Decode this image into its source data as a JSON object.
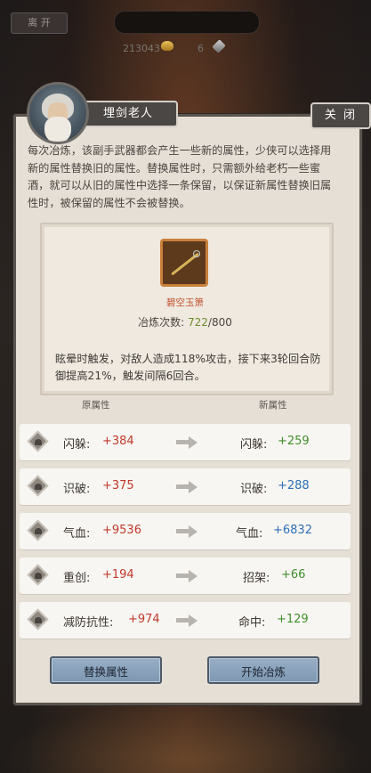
{
  "topbar": {
    "leave_label": "离 开",
    "title": "",
    "coins": "213043",
    "gems": "6",
    "coin_icon": "coin-icon",
    "gem_icon": "gem-icon"
  },
  "npc": {
    "name": "埋剑老人",
    "avatar_icon": "old-sage-avatar"
  },
  "close_label": "关 闭",
  "description": "每次冶炼，该副手武器都会产生一些新的属性，少侠可以选择用新的属性替换旧的属性。替换属性时，只需额外给老朽一些蜜酒，就可以从旧的属性中选择一条保留，以保证新属性替换旧属性时，被保留的属性不会被替换。",
  "item": {
    "name": "碧空玉箫",
    "refine_label": "冶炼次数:",
    "refine_current": "722",
    "refine_max": "/800",
    "effect": "眩晕时触发，对敌人造成118%攻击，接下来3轮回合防御提高21%，触发间隔6回合。",
    "icon": "jade-flute-icon"
  },
  "headers": {
    "old": "原属性",
    "new": "新属性"
  },
  "attributes": [
    {
      "old_label": "闪躲:",
      "old_value": "+384",
      "new_label": "闪躲:",
      "new_value": "+259",
      "new_color": "#3f8f2a"
    },
    {
      "old_label": "识破:",
      "old_value": "+375",
      "new_label": "识破:",
      "new_value": "+288",
      "new_color": "#2f6fb5"
    },
    {
      "old_label": "气血:",
      "old_value": "+9536",
      "new_label": "气血:",
      "new_value": "+6832",
      "new_color": "#2f6fb5"
    },
    {
      "old_label": "重创:",
      "old_value": "+194",
      "new_label": "招架:",
      "new_value": "+66",
      "new_color": "#3f8f2a"
    },
    {
      "old_label": "减防抗性:",
      "old_value": "+974",
      "new_label": "命中:",
      "new_value": "+129",
      "new_color": "#3f8f2a"
    }
  ],
  "buttons": {
    "replace": "替换属性",
    "start": "开始冶炼"
  },
  "colors": {
    "old_value": "#c0392b",
    "accent_button": "#8aa3bd",
    "item_name": "#c0542e"
  }
}
